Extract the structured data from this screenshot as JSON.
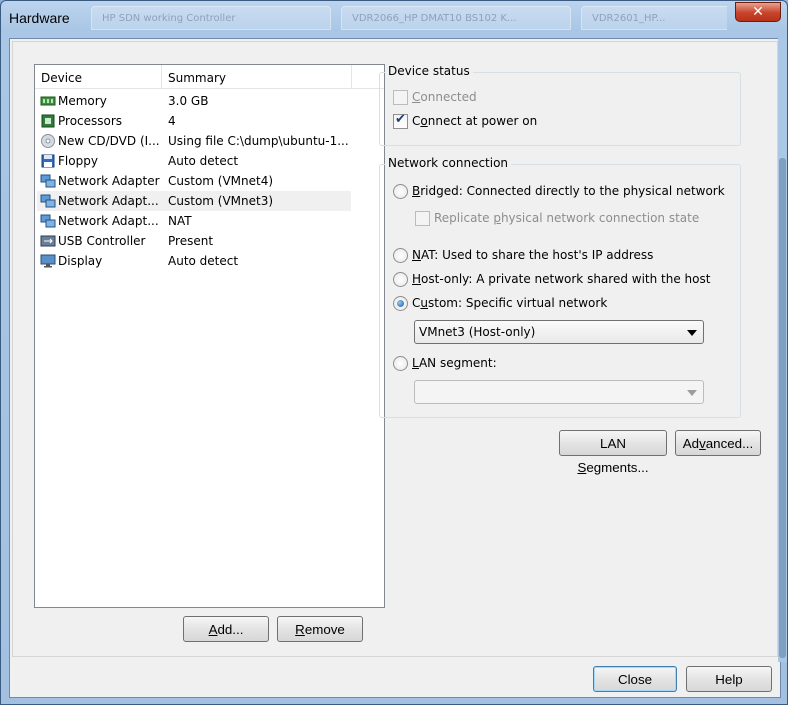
{
  "window": {
    "title": "Hardware",
    "close_glyph": "✕",
    "background_tabs": [
      "HP SDN working Controller",
      "VDR2066_HP DMAT10 BS102 K...",
      "VDR2601_HP..."
    ]
  },
  "device_list": {
    "columns": [
      "Device",
      "Summary"
    ],
    "rows": [
      {
        "device": "Memory",
        "summary": "3.0 GB",
        "icon": "memory-icon"
      },
      {
        "device": "Processors",
        "summary": "4",
        "icon": "processor-icon"
      },
      {
        "device": "New CD/DVD (I...",
        "summary": "Using file C:\\dump\\ubuntu-1...",
        "icon": "cd-dvd-icon"
      },
      {
        "device": "Floppy",
        "summary": "Auto detect",
        "icon": "floppy-icon"
      },
      {
        "device": "Network Adapter",
        "summary": "Custom (VMnet4)",
        "icon": "network-adapter-icon"
      },
      {
        "device": "Network Adapt...",
        "summary": "Custom (VMnet3)",
        "icon": "network-adapter-icon",
        "selected": true
      },
      {
        "device": "Network Adapt...",
        "summary": "NAT",
        "icon": "network-adapter-icon"
      },
      {
        "device": "USB Controller",
        "summary": "Present",
        "icon": "usb-icon"
      },
      {
        "device": "Display",
        "summary": "Auto detect",
        "icon": "display-icon"
      }
    ],
    "add_button": "Add...",
    "remove_button": "Remove"
  },
  "device_status": {
    "title": "Device status",
    "connected_label": "Connected",
    "connected_checked": false,
    "connect_power_on_label": "Connect at power on",
    "connect_power_on_checked": true
  },
  "network_connection": {
    "title": "Network connection",
    "bridged_label": "Bridged: Connected directly to the physical network",
    "replicate_label": "Replicate physical network connection state",
    "nat_label": "NAT: Used to share the host's IP address",
    "hostonly_label": "Host-only: A private network shared with the host",
    "custom_label": "Custom: Specific virtual network",
    "custom_selected_value": "VMnet3 (Host-only)",
    "lan_segment_label": "LAN segment:",
    "lan_segment_value": "",
    "selected": "custom"
  },
  "buttons": {
    "lan_segments": "LAN Segments...",
    "advanced": "Advanced...",
    "close": "Close",
    "help": "Help"
  }
}
